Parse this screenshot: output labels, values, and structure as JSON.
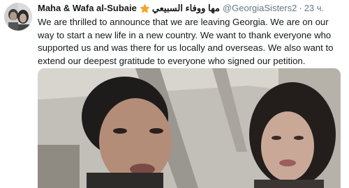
{
  "tweet": {
    "author_name": "Maha & Wafa al-Subaie",
    "author_name_arabic": "مها ووفاء السبيعي",
    "handle": "@GeorgiaSisters2",
    "separator": "·",
    "timestamp": "23 ч.",
    "text": "We are thrilled to announce that we are leaving Georgia. We are on our way to start a new life in a new country. We want to thank everyone who supported us and was there for us locally and overseas. We also want to extend our deepest gratitude to everyone who signed our petition."
  },
  "icons": {
    "badge": "star-emoji-icon",
    "avatar": "profile-photo",
    "media": "video-thumbnail"
  },
  "colors": {
    "text": "#14171a",
    "secondary": "#657786",
    "star": "#f5a623"
  }
}
